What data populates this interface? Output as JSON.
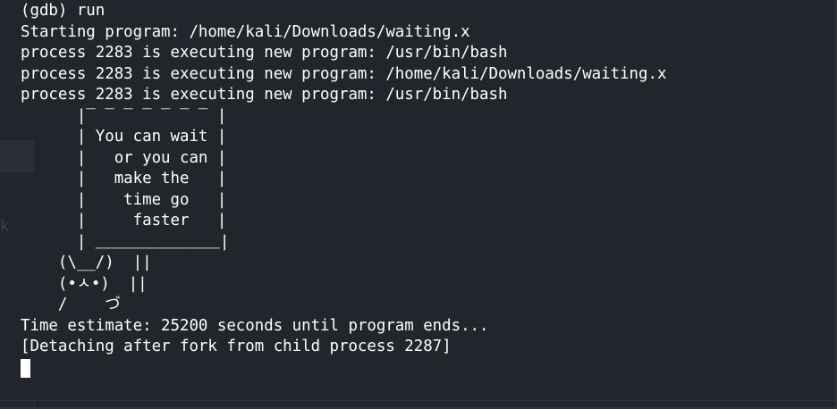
{
  "terminal": {
    "lines": [
      "(gdb) run",
      "Starting program: /home/kali/Downloads/waiting.x",
      "process 2283 is executing new program: /usr/bin/bash",
      "process 2283 is executing new program: /home/kali/Downloads/waiting.x",
      "process 2283 is executing new program: /usr/bin/bash",
      "      |‾ ‾ ‾ ‾ ‾ ‾ ‾ |",
      "      | You can wait |",
      "      |   or you can |",
      "      |   make the   |",
      "      |    time go   |",
      "      |     faster   |",
      "      | ＿＿＿＿＿＿＿＿|",
      "    (\\__/)  ||",
      "    (•ㅅ•)  ||",
      "    /    づ",
      "Time estimate: 25200 seconds until program ends...",
      "[Detaching after fork from child process 2287]"
    ],
    "side_glyph": "k"
  },
  "colors": {
    "background": "#22252c",
    "text": "#ffffff",
    "cursor": "#ffffff"
  }
}
